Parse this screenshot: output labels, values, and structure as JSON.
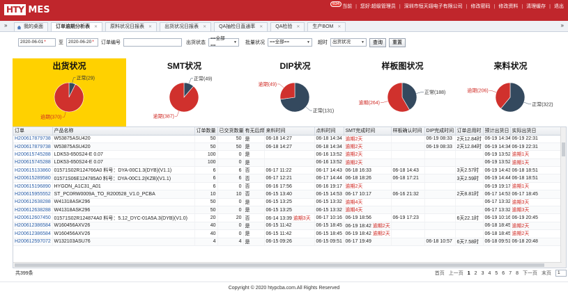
{
  "header": {
    "logo_box": "HTY",
    "logo_text": "MES",
    "notify_count": "634",
    "nav": [
      "当前",
      "您好:超级管理员",
      "深圳市恒天翊电子有限公司",
      "修改密码",
      "修改资料",
      "清理缓存",
      "退出"
    ]
  },
  "tabs": [
    {
      "label": "我的桌面"
    },
    {
      "label": "订单逾期分析表"
    },
    {
      "label": "原料状况日报表"
    },
    {
      "label": "出货状况日报表"
    },
    {
      "label": "QA抽检日直通率"
    },
    {
      "label": "QA检验"
    },
    {
      "label": "生产BOM"
    }
  ],
  "filters": {
    "date_from": "2020-06-01",
    "date_to_label": "至",
    "date_to": "2020-06-20",
    "order_no_label": "订单编号",
    "order_no_value": "",
    "ship_status_label": "出货状态",
    "ship_status_value": "==全部==",
    "batch_status_label": "批量状况",
    "batch_status_value": "==全部==",
    "overdue_label": "超时",
    "overdue_value": "出货状况",
    "query_button": "查询",
    "reset_button": "重置"
  },
  "chart_data": [
    {
      "type": "pie",
      "title": "出货状况",
      "categories": [
        "正常",
        "逾期"
      ],
      "values": [
        29,
        370
      ],
      "labels": [
        "正常(29)",
        "逾期(370)"
      ],
      "colors": [
        "#34495e",
        "#d0312d"
      ]
    },
    {
      "type": "pie",
      "title": "SMT状况",
      "categories": [
        "正常",
        "逾期"
      ],
      "values": [
        49,
        387
      ],
      "labels": [
        "正常(49)",
        "逾期(387)"
      ],
      "colors": [
        "#34495e",
        "#d0312d"
      ]
    },
    {
      "type": "pie",
      "title": "DIP状况",
      "categories": [
        "正常",
        "逾期"
      ],
      "values": [
        131,
        49
      ],
      "labels": [
        "正常(131)",
        "逾期(49)"
      ],
      "colors": [
        "#34495e",
        "#d0312d"
      ]
    },
    {
      "type": "pie",
      "title": "样板图状况",
      "categories": [
        "正常",
        "逾期"
      ],
      "values": [
        188,
        264
      ],
      "labels": [
        "正常(188)",
        "逾期(264)"
      ],
      "colors": [
        "#34495e",
        "#d0312d"
      ]
    },
    {
      "type": "pie",
      "title": "来料状况",
      "categories": [
        "正常",
        "逾期"
      ],
      "values": [
        322,
        206
      ],
      "labels": [
        "正常(322)",
        "逾期(206)"
      ],
      "colors": [
        "#34495e",
        "#d0312d"
      ]
    }
  ],
  "table": {
    "columns": [
      "订单",
      "产品名称",
      "订单数量",
      "已交货数量",
      "有无后焊",
      "来料时间",
      "点料时间",
      "SMT完成时间",
      "样板确认时间",
      "DIP完成时间",
      "订单总用时",
      "预计出货日",
      "实际出货日"
    ],
    "rows": [
      [
        "H200617879738",
        "W53875ASU420",
        "50",
        "50",
        "是",
        "06-18 14:27",
        "06-18 14:34",
        "逾期2天",
        "",
        "06-19 08:33",
        "2天12.84时",
        "06-19 14:34",
        "06-19 22:31"
      ],
      [
        "H200617879738",
        "W53875ASU420",
        "50",
        "50",
        "是",
        "06-18 14:27",
        "06-18 14:34",
        "逾期2天",
        "",
        "06-19 08:33",
        "2天12.84时",
        "06-19 14:34",
        "06-19 22:31"
      ],
      [
        "H200615745288",
        "LDK53-650S24-E 0.07",
        "100",
        "0",
        "是",
        "",
        "06-16 13:52",
        "逾期2天",
        "",
        "",
        "",
        "06-19 13:52",
        "逾期1天"
      ],
      [
        "H200615745288",
        "LDK53-650S24-E 0.07",
        "100",
        "0",
        "是",
        "",
        "06-16 13:52",
        "逾期2天",
        "",
        "",
        "",
        "06-19 13:52",
        "逾期1天"
      ],
      [
        "H200615133860",
        "01571S02R124766A0 料号：DYA-00C1.3(DYB)(V1.1)",
        "6",
        "6",
        "否",
        "06-17 11:22",
        "06-17 14:43",
        "06-18 16:33",
        "06-18 14:43",
        "",
        "3天2.57时",
        "06-19 14:43",
        "06-18 18:51"
      ],
      [
        "H200615289580",
        "01571S06E124785A0 料号：DYA-00C1.2(KZB)(V1.1)",
        "6",
        "6",
        "否",
        "06-17 12:21",
        "06-17 14:44",
        "06-18 18:26",
        "06-18 17:21",
        "",
        "3天2.59时",
        "06-19 14:44",
        "06-18 18:51"
      ],
      [
        "H200615196890",
        "HYGON_A1C31_A01",
        "6",
        "0",
        "否",
        "06-16 17:56",
        "06-16 19:17",
        "逾期2天",
        "",
        "",
        "",
        "06-19 19:17",
        "逾期1天"
      ],
      [
        "H200615955552",
        "ST_PC0RW0009A_TO_R200528_V1.0_PCBA",
        "10",
        "10",
        "否",
        "06-15 13:40",
        "06-15 14:53",
        "06-17 10:17",
        "06-16 21:32",
        "",
        "2天8.81时",
        "06-17 14:53",
        "06-17 18:45"
      ],
      [
        "H200612638288",
        "W41318ASK296",
        "50",
        "0",
        "是",
        "06-15 13:25",
        "06-15 13:32",
        "逾期4天",
        "",
        "",
        "",
        "06-17 13:32",
        "逾期3天"
      ],
      [
        "H200612638288",
        "W41318ASK296",
        "50",
        "0",
        "是",
        "06-15 13:25",
        "06-15 13:32",
        "逾期4天",
        "",
        "",
        "",
        "06-17 13:32",
        "逾期3天"
      ],
      [
        "H200612607450",
        "01571S02R124874A0 料号：5.12_DYC-01A5A.3(DYB)(V1.0)",
        "20",
        "20",
        "否",
        "06-14 13:39|逾期3天",
        "06-17 10:16",
        "06-19 18:56",
        "06-19 17:23",
        "",
        "6天22.1时",
        "06-19 10:16",
        "06-19 20:45"
      ],
      [
        "H200612386584",
        "W160456AXV26",
        "40",
        "0",
        "是",
        "06-15 11:42",
        "06-15 18:45",
        "06-19 18:42|逾期2天",
        "",
        "",
        "",
        "06-18 18:45",
        "逾期2天"
      ],
      [
        "H200612386584",
        "W160456AXV26",
        "40",
        "0",
        "是",
        "06-15 11:42",
        "06-15 18:45",
        "06-19 18:42|逾期2天",
        "",
        "",
        "",
        "06-18 18:45",
        "逾期2天"
      ],
      [
        "H200612597072",
        "W132103ASU76",
        "4",
        "4",
        "是",
        "06-15 09:26",
        "06-15 09:51",
        "06-17 19:49",
        "",
        "06-18 10:57",
        "6天7.58时",
        "06-18 09:51",
        "06-18 20:48"
      ]
    ]
  },
  "pager": {
    "total": "共399条",
    "first": "首页",
    "prev": "上一页",
    "pages": [
      "1",
      "2",
      "3",
      "4",
      "5",
      "6",
      "7",
      "8"
    ],
    "current": "1",
    "next": "下一页",
    "last": "末页",
    "page_input": "1"
  },
  "footer": {
    "copyright": "Copyright © 2020 htypcba.com.All Rights Reserved"
  }
}
